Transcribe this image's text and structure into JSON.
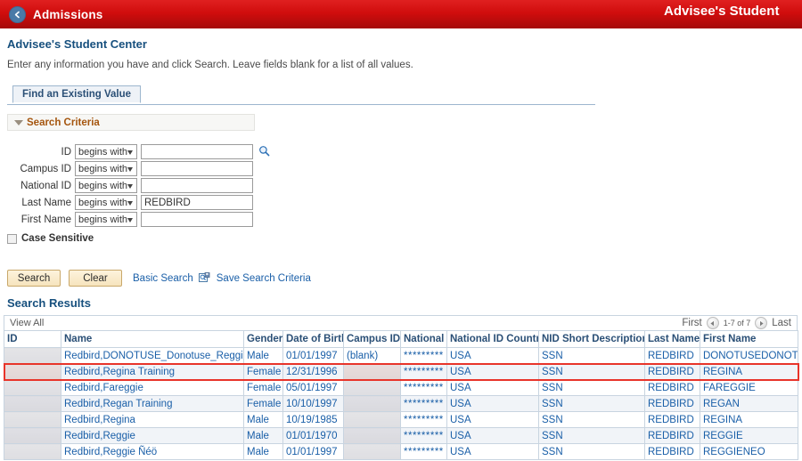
{
  "banner": {
    "back_icon": "chevron-left-icon",
    "left_label": "Admissions",
    "title": "Advisee's Student"
  },
  "page": {
    "title": "Advisee's Student Center",
    "instructions": "Enter any information you have and click Search. Leave fields blank for a list of all values."
  },
  "tabs": [
    {
      "label": "Find an Existing Value",
      "selected": true
    }
  ],
  "search_criteria": {
    "section_label": "Search Criteria",
    "collapse_icon": "triangle-down-icon",
    "fields": [
      {
        "label": "ID",
        "operator": "begins with",
        "value": "",
        "has_lookup": true
      },
      {
        "label": "Campus ID",
        "operator": "begins with",
        "value": "",
        "has_lookup": false
      },
      {
        "label": "National ID",
        "operator": "begins with",
        "value": "",
        "has_lookup": false
      },
      {
        "label": "Last Name",
        "operator": "begins with",
        "value": "REDBIRD",
        "has_lookup": false
      },
      {
        "label": "First Name",
        "operator": "begins with",
        "value": "",
        "has_lookup": false
      }
    ],
    "case_sensitive": {
      "label": "Case Sensitive",
      "checked": false
    },
    "lookup_icon": "magnifier-icon"
  },
  "actions": {
    "search_label": "Search",
    "clear_label": "Clear",
    "basic_search_label": "Basic Search",
    "save_criteria_icon": "save-search-icon",
    "save_criteria_label": "Save Search Criteria"
  },
  "results": {
    "title": "Search Results",
    "view_all_label": "View All",
    "pager": {
      "first_label": "First",
      "prev_icon": "arrow-left-icon",
      "range": "1-7 of 7",
      "next_icon": "arrow-right-icon",
      "last_label": "Last"
    },
    "columns": [
      "ID",
      "Name",
      "Gender",
      "Date of Birth",
      "Campus ID",
      "National ID",
      "National ID Country",
      "NID Short Description",
      "Last Name",
      "First Name"
    ],
    "rows": [
      {
        "id": "",
        "id_redacted": true,
        "name": "Redbird,DONOTUSE_Donotuse_Reggie O",
        "gender": "Male",
        "dob": "01/01/1997",
        "campus_id": "(blank)",
        "campus_id_redacted": false,
        "national_id": "*********",
        "national_id_country": "USA",
        "nid_short_description": "SSN",
        "last_name": "REDBIRD",
        "first_name": "DONOTUSEDONOTUSEREGGIE",
        "highlighted": false
      },
      {
        "id": "",
        "id_redacted": true,
        "name": "Redbird,Regina Training",
        "gender": "Female",
        "dob": "12/31/1996",
        "campus_id": "",
        "campus_id_redacted": true,
        "national_id": "*********",
        "national_id_country": "USA",
        "nid_short_description": "SSN",
        "last_name": "REDBIRD",
        "first_name": "REGINA",
        "highlighted": true
      },
      {
        "id": "",
        "id_redacted": true,
        "name": "Redbird,Fareggie",
        "gender": "Female",
        "dob": "05/01/1997",
        "campus_id": "",
        "campus_id_redacted": true,
        "national_id": "*********",
        "national_id_country": "USA",
        "nid_short_description": "SSN",
        "last_name": "REDBIRD",
        "first_name": "FAREGGIE",
        "highlighted": false
      },
      {
        "id": "",
        "id_redacted": true,
        "name": "Redbird,Regan Training",
        "gender": "Female",
        "dob": "10/10/1997",
        "campus_id": "",
        "campus_id_redacted": true,
        "national_id": "*********",
        "national_id_country": "USA",
        "nid_short_description": "SSN",
        "last_name": "REDBIRD",
        "first_name": "REGAN",
        "highlighted": false
      },
      {
        "id": "",
        "id_redacted": true,
        "name": "Redbird,Regina",
        "gender": "Male",
        "dob": "10/19/1985",
        "campus_id": "",
        "campus_id_redacted": true,
        "national_id": "*********",
        "national_id_country": "USA",
        "nid_short_description": "SSN",
        "last_name": "REDBIRD",
        "first_name": "REGINA",
        "highlighted": false
      },
      {
        "id": "",
        "id_redacted": true,
        "name": "Redbird,Reggie",
        "gender": "Male",
        "dob": "01/01/1970",
        "campus_id": "",
        "campus_id_redacted": true,
        "national_id": "*********",
        "national_id_country": "USA",
        "nid_short_description": "SSN",
        "last_name": "REDBIRD",
        "first_name": "REGGIE",
        "highlighted": false
      },
      {
        "id": "",
        "id_redacted": true,
        "name": "Redbird,Reggie Ñéö",
        "gender": "Male",
        "dob": "01/01/1997",
        "campus_id": "",
        "campus_id_redacted": true,
        "national_id": "*********",
        "national_id_country": "USA",
        "nid_short_description": "SSN",
        "last_name": "REDBIRD",
        "first_name": "REGGIENEO",
        "highlighted": false
      }
    ]
  },
  "colors": {
    "banner_red": "#d00d0d",
    "link_blue": "#1a5fa8",
    "heading_blue": "#17507e",
    "section_orange": "#a5560f",
    "highlight_red": "#e8342a"
  }
}
